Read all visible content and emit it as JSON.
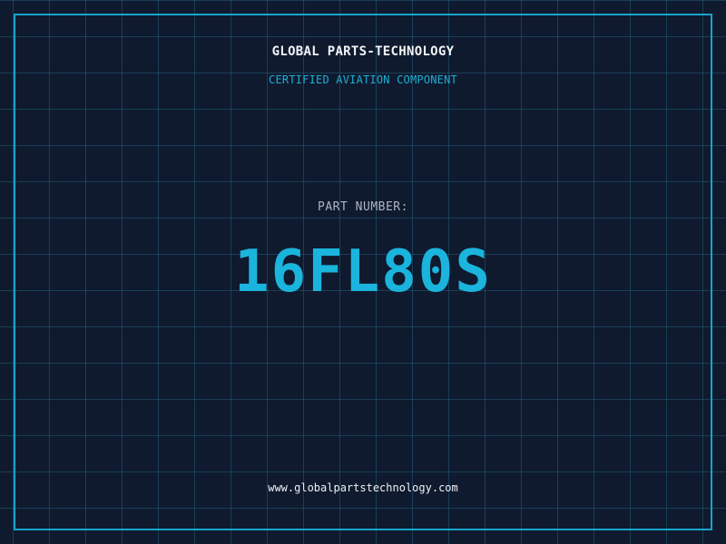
{
  "header": {
    "company": "GLOBAL PARTS-TECHNOLOGY",
    "subtitle": "CERTIFIED AVIATION COMPONENT"
  },
  "part": {
    "label": "PART NUMBER:",
    "number": "16FL80S"
  },
  "footer": {
    "website": "www.globalpartstechnology.com"
  },
  "colors": {
    "background": "#0f1a2e",
    "accent": "#1ab4dc",
    "border": "#1aa3c9",
    "text_primary": "#f2f4f7",
    "text_muted": "#aeb6c2"
  }
}
